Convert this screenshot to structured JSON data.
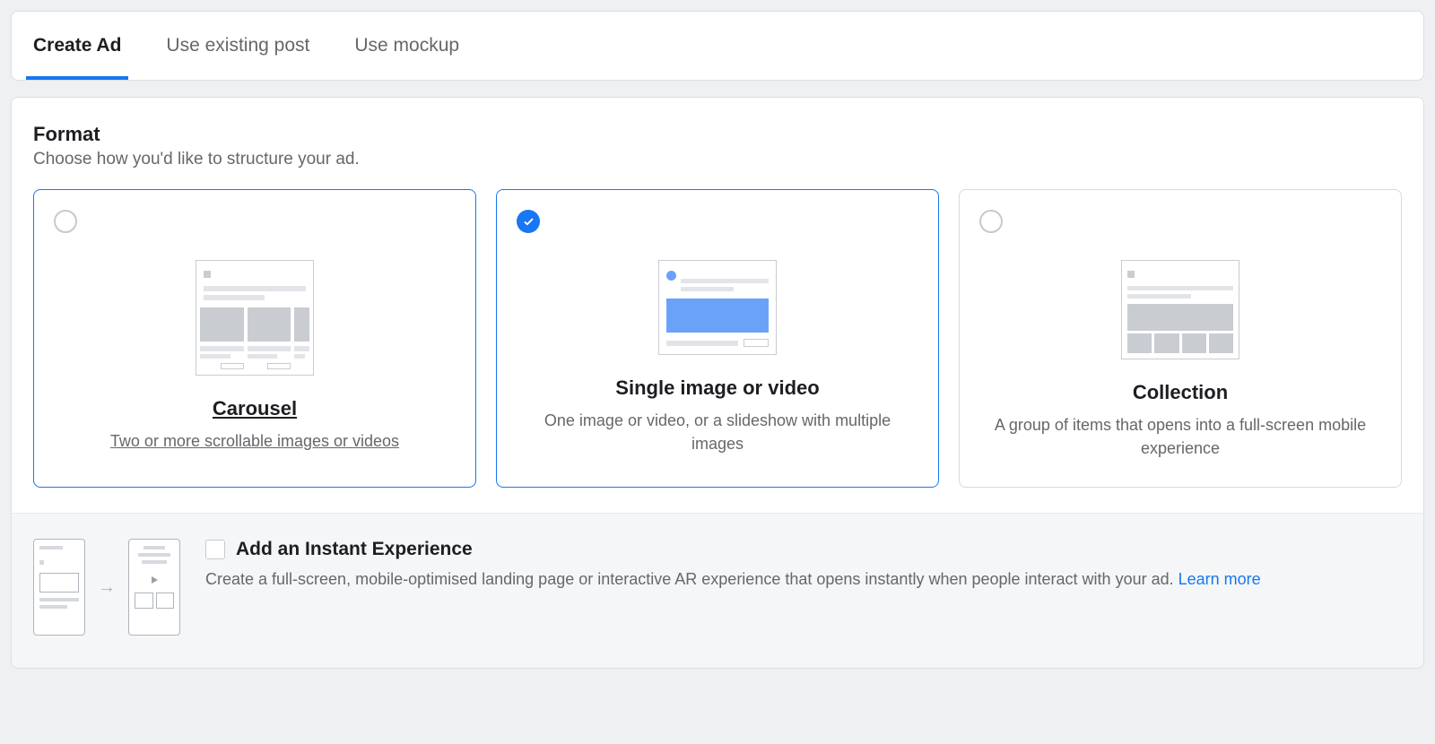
{
  "tabs": {
    "create_ad": "Create Ad",
    "existing_post": "Use existing post",
    "mockup": "Use mockup"
  },
  "format": {
    "heading": "Format",
    "sub": "Choose how you'd like to structure your ad."
  },
  "options": {
    "carousel": {
      "title": "Carousel",
      "desc": "Two or more scrollable images or videos"
    },
    "single": {
      "title": "Single image or video",
      "desc": "One image or video, or a slideshow with multiple images"
    },
    "collection": {
      "title": "Collection",
      "desc": "A group of items that opens into a full-screen mobile experience"
    }
  },
  "instant": {
    "title": "Add an Instant Experience",
    "desc": "Create a full-screen, mobile-optimised landing page or interactive AR experience that opens instantly when people interact with your ad. ",
    "learn": "Learn more"
  }
}
